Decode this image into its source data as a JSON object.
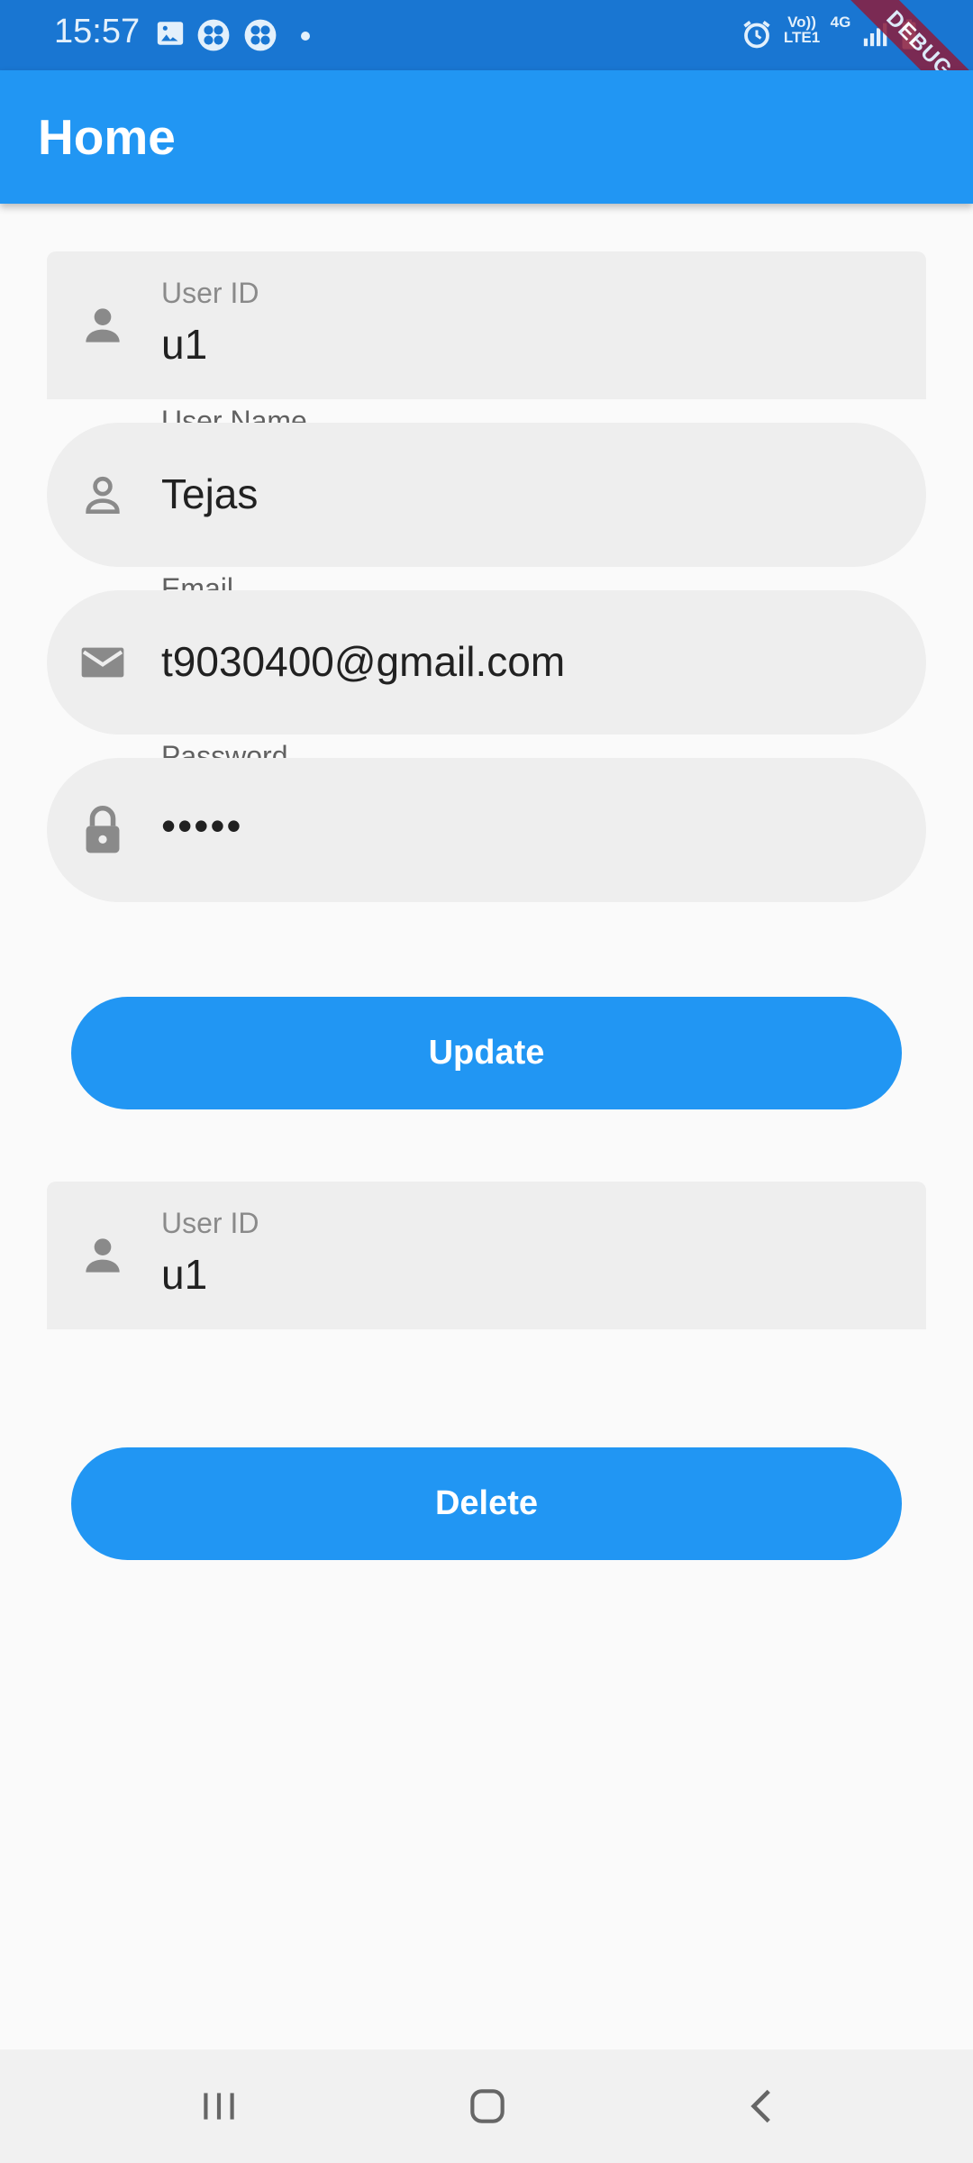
{
  "status_bar": {
    "time": "15:57",
    "volte": "Vo)) LTE1",
    "network": "4G",
    "icons": [
      "gallery-icon",
      "fan-icon",
      "fan-icon",
      "dot-icon",
      "alarm-icon",
      "signal-icon",
      "battery-icon"
    ]
  },
  "debug_banner": "DEBUG",
  "app_bar": {
    "title": "Home"
  },
  "update_form": {
    "user_id": {
      "label": "User ID",
      "value": "u1",
      "icon": "person-icon"
    },
    "user_name": {
      "label": "User Name",
      "value": "Tejas",
      "icon": "person-outline-icon"
    },
    "email": {
      "label": "Email",
      "value": "t9030400@gmail.com",
      "icon": "mail-icon"
    },
    "password": {
      "label": "Password",
      "value": "•••••",
      "icon": "lock-icon"
    },
    "update_button": "Update"
  },
  "delete_form": {
    "user_id": {
      "label": "User ID",
      "value": "u1",
      "icon": "person-icon"
    },
    "delete_button": "Delete"
  },
  "nav_bar": {
    "icons": [
      "recents-icon",
      "home-icon",
      "back-icon"
    ]
  },
  "colors": {
    "primary": "#2196f3",
    "status_bar": "#1976d2",
    "field_fill": "#eeeeee",
    "icon_gray": "#8a8a8a",
    "background": "#fafafa"
  }
}
